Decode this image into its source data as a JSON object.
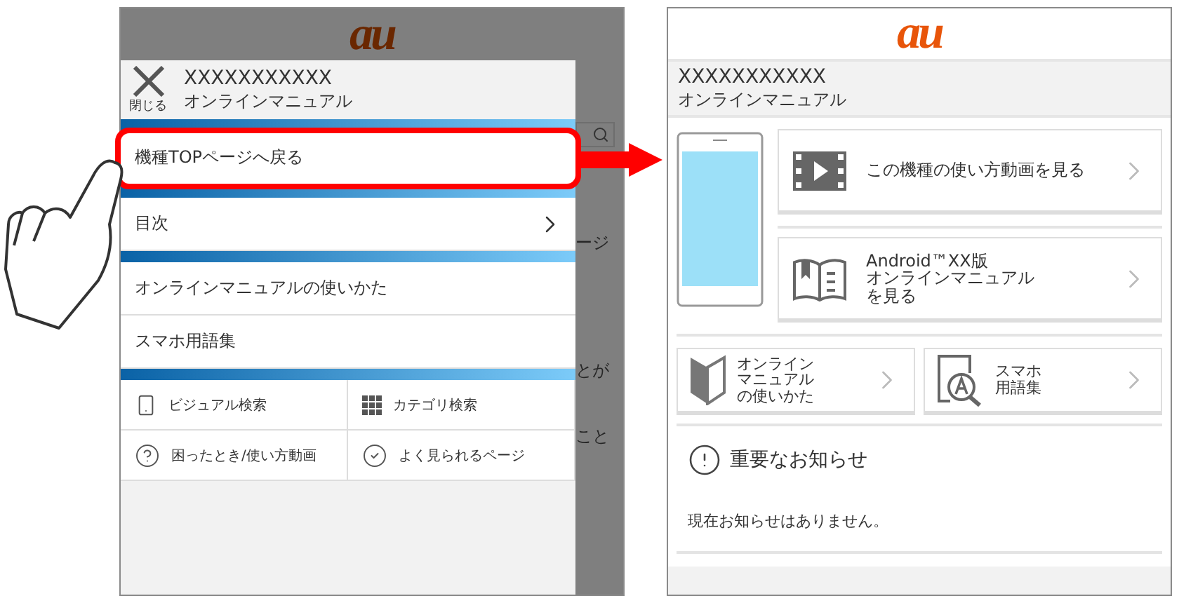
{
  "left_screen": {
    "logo": "au",
    "background_fragments": [
      "ージ",
      "とが",
      "こと"
    ],
    "drawer": {
      "close_label": "閉じる",
      "title": "XXXXXXXXXXX",
      "subtitle": "オンラインマニュアル",
      "sections": [
        [
          {
            "label": "機種TOPページへ戻る",
            "chevron": false,
            "highlighted": true
          }
        ],
        [
          {
            "label": "目次",
            "chevron": true,
            "highlighted": false
          }
        ],
        [
          {
            "label": "オンラインマニュアルの使いかた",
            "chevron": false,
            "highlighted": false
          },
          {
            "label": "スマホ用語集",
            "chevron": false,
            "highlighted": false
          }
        ]
      ],
      "quick_links": [
        {
          "label": "ビジュアル検索",
          "kind": "phone"
        },
        {
          "label": "カテゴリ検索",
          "kind": "grid"
        },
        {
          "label": "困ったとき/使い方動画",
          "kind": "help"
        },
        {
          "label": "よく見られるページ",
          "kind": "check"
        }
      ]
    }
  },
  "right_screen": {
    "logo": "au",
    "title": "XXXXXXXXXXX",
    "subtitle": "オンラインマニュアル",
    "main_links": [
      {
        "lines": [
          "この機種の使い方動画を見る"
        ],
        "kind": "video"
      },
      {
        "lines": [
          "Android™XX版",
          "オンラインマニュアル",
          "を見る"
        ],
        "kind": "book"
      }
    ],
    "sub_links": [
      {
        "lines": [
          "オンライン",
          "マニュアル",
          "の使いかた"
        ],
        "kind": "beginner"
      },
      {
        "lines": [
          "スマホ",
          "用語集"
        ],
        "kind": "glossary"
      }
    ],
    "notice": {
      "title": "重要なお知らせ",
      "text": "現在お知らせはありません。"
    }
  }
}
